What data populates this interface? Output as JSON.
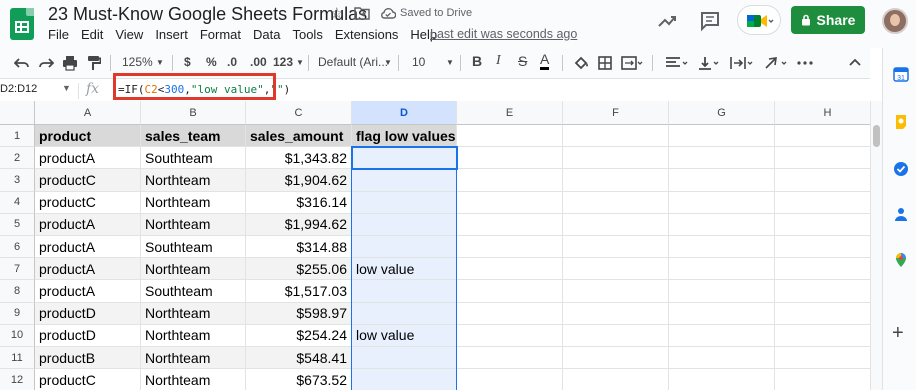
{
  "app": {
    "doc_title": "23 Must-Know Google Sheets Formulas",
    "saved_status": "Saved to Drive",
    "last_edit": "Last edit was seconds ago",
    "share_label": "Share"
  },
  "menu": [
    "File",
    "Edit",
    "View",
    "Insert",
    "Format",
    "Data",
    "Tools",
    "Extensions",
    "Help"
  ],
  "toolbar": {
    "zoom": "125%",
    "currency": "$",
    "percent": "%",
    "dec_decrease": ".0",
    "dec_increase": ".00",
    "more_formats": "123",
    "font": "Default (Ari...",
    "font_size": "10",
    "bold": "B",
    "italic": "I",
    "strike": "S",
    "text_color": "A"
  },
  "formula_bar": {
    "name_box": "D2:D12",
    "name_box_visible": "D2:D12",
    "fx": "fx",
    "formula_parts": [
      "=IF(",
      "C2",
      "<",
      "300",
      ",",
      "\"low value\"",
      ",",
      "\"\"",
      ")"
    ]
  },
  "columns": [
    "A",
    "B",
    "C",
    "D",
    "E",
    "F",
    "G",
    "H"
  ],
  "rows": [
    {
      "n": "1",
      "a": "product",
      "b": "sales_team",
      "c": "sales_amount",
      "d": "flag low values"
    },
    {
      "n": "2",
      "a": "productA",
      "b": "Southteam",
      "c": "$1,343.82",
      "d": ""
    },
    {
      "n": "3",
      "a": "productC",
      "b": "Northteam",
      "c": "$1,904.62",
      "d": ""
    },
    {
      "n": "4",
      "a": "productC",
      "b": "Northteam",
      "c": "$316.14",
      "d": ""
    },
    {
      "n": "5",
      "a": "productA",
      "b": "Northteam",
      "c": "$1,994.62",
      "d": ""
    },
    {
      "n": "6",
      "a": "productA",
      "b": "Southteam",
      "c": "$314.88",
      "d": ""
    },
    {
      "n": "7",
      "a": "productA",
      "b": "Northteam",
      "c": "$255.06",
      "d": "low value"
    },
    {
      "n": "8",
      "a": "productA",
      "b": "Southteam",
      "c": "$1,517.03",
      "d": ""
    },
    {
      "n": "9",
      "a": "productD",
      "b": "Northteam",
      "c": "$598.97",
      "d": ""
    },
    {
      "n": "10",
      "a": "productD",
      "b": "Northteam",
      "c": "$254.24",
      "d": "low value"
    },
    {
      "n": "11",
      "a": "productB",
      "b": "Northteam",
      "c": "$548.41",
      "d": ""
    },
    {
      "n": "12",
      "a": "productC",
      "b": "Northteam",
      "c": "$673.52",
      "d": ""
    }
  ],
  "colors": {
    "share_green": "#1e8e3e",
    "formula_highlight": "#e0392b",
    "selection_blue": "#1a73e8",
    "header_fill": "#d9d9d9"
  },
  "icons": [
    "undo-icon",
    "redo-icon",
    "print-icon",
    "paint-format-icon",
    "star-icon",
    "move-to-folder-icon",
    "cloud-saved-icon",
    "trend-icon",
    "comment-icon",
    "meet-icon",
    "lock-icon",
    "calendar-icon",
    "keep-icon",
    "tasks-icon",
    "contacts-icon",
    "maps-icon",
    "add-icon"
  ]
}
